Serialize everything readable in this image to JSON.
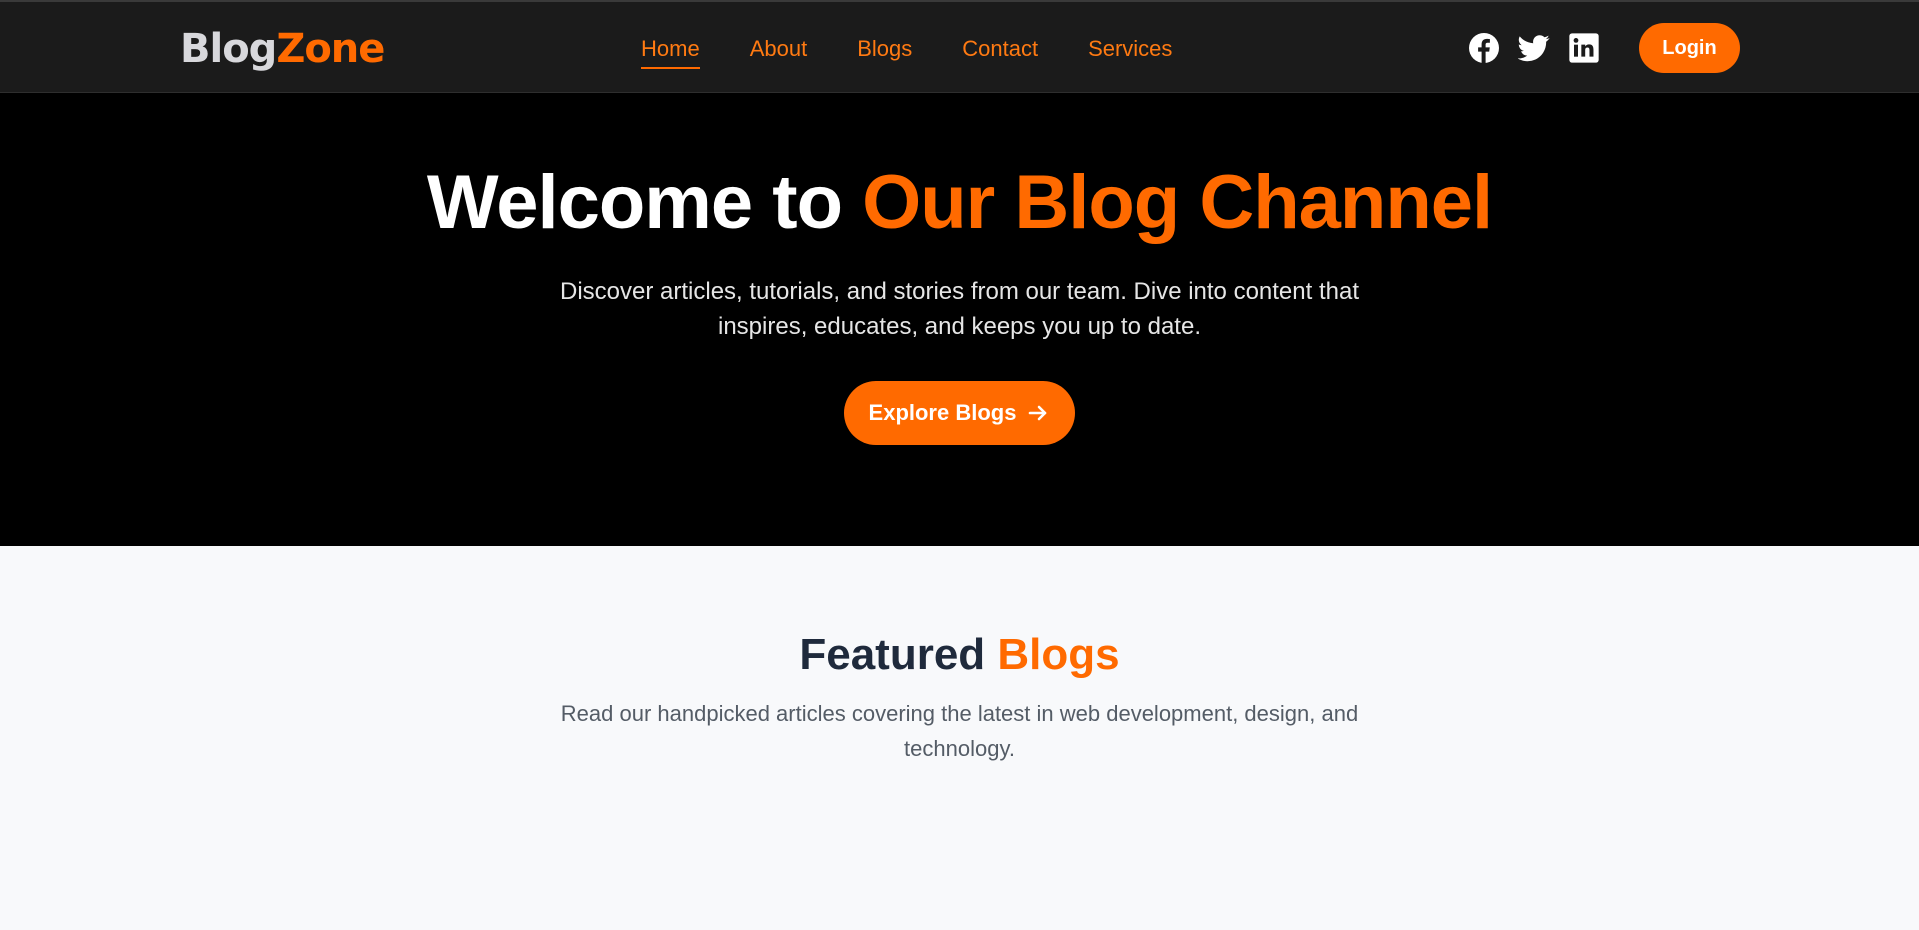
{
  "header": {
    "logo": {
      "part1": "Blog",
      "part2": "Zone"
    },
    "nav": [
      {
        "label": "Home",
        "active": true
      },
      {
        "label": "About",
        "active": false
      },
      {
        "label": "Blogs",
        "active": false
      },
      {
        "label": "Contact",
        "active": false
      },
      {
        "label": "Services",
        "active": false
      }
    ],
    "socials": [
      "facebook-icon",
      "twitter-icon",
      "linkedin-icon"
    ],
    "login_label": "Login"
  },
  "hero": {
    "title_plain": "Welcome to",
    "title_accent": "Our Blog Channel",
    "subtitle": "Discover articles, tutorials, and stories from our team. Dive into content that inspires, educates, and keeps you up to date.",
    "cta_label": "Explore Blogs",
    "cta_icon": "arrow-right-icon"
  },
  "featured": {
    "title_plain": "Featured",
    "title_accent": "Blogs",
    "subtitle": "Read our handpicked articles covering the latest in web development, design, and technology."
  },
  "colors": {
    "accent": "#ff6a00",
    "nav_bg": "#1b1b1b",
    "hero_bg": "#000000",
    "section_bg": "#f8f9fb",
    "heading_dark": "#1f2a3c"
  }
}
